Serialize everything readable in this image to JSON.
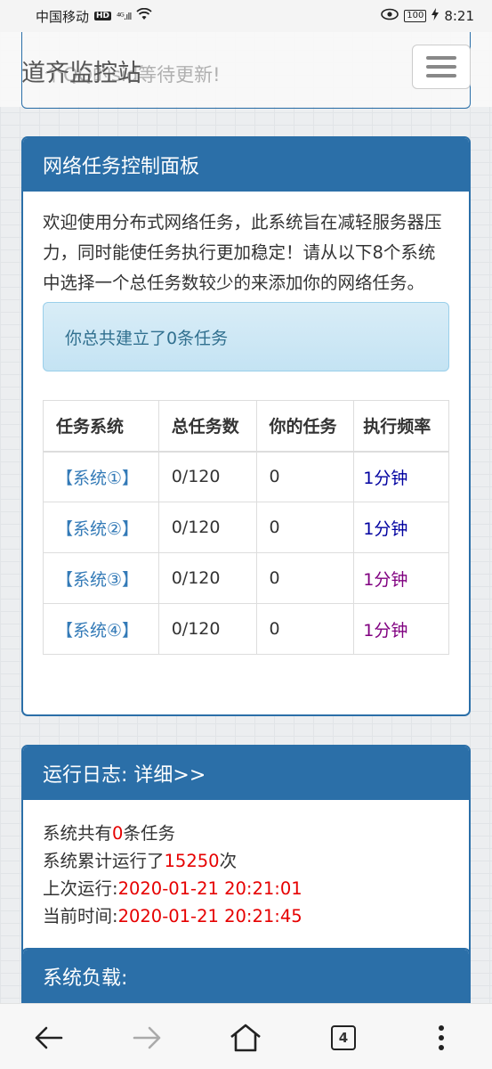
{
  "status_bar": {
    "carrier": "中国移动",
    "hd": "HD",
    "signal": "⁴ᴳ.ıll",
    "battery": "100",
    "time": "8:21"
  },
  "navbar": {
    "brand": "道齐监控站",
    "scrolled_text": "个QQ的sid等待更新!"
  },
  "task_panel": {
    "title": "网络任务控制面板",
    "intro": "欢迎使用分布式网络任务，此系统旨在减轻服务器压力，同时能使任务执行更加稳定！请从以下8个系统中选择一个总任务数较少的来添加你的网络任务。",
    "alert": "你总共建立了0条任务",
    "table": {
      "headers": [
        "任务系统",
        "总任务数",
        "你的任务",
        "执行频率"
      ],
      "rows": [
        {
          "system": "【系统①】",
          "total": "0/120",
          "mine": "0",
          "freq": "1分钟"
        },
        {
          "system": "【系统②】",
          "total": "0/120",
          "mine": "0",
          "freq": "1分钟"
        },
        {
          "system": "【系统③】",
          "total": "0/120",
          "mine": "0",
          "freq": "1分钟"
        },
        {
          "system": "【系统④】",
          "total": "0/120",
          "mine": "0",
          "freq": "1分钟"
        }
      ]
    }
  },
  "log_panel": {
    "title": "运行日志: 详细>>",
    "line1_prefix": "系统共有",
    "line1_value": "0",
    "line1_suffix": "条任务",
    "line2_prefix": "系统累计运行了",
    "line2_value": "15250",
    "line2_suffix": "次",
    "line3_prefix": "上次运行:",
    "line3_value": "2020-01-21 20:21:01",
    "line4_prefix": "当前时间:",
    "line4_value": "2020-01-21 20:21:45"
  },
  "load_panel": {
    "title": "系统负载:"
  },
  "bottom_nav": {
    "tabs_count": "4"
  },
  "colors": {
    "panel_primary": "#2b6fa8",
    "link": "#337ab7",
    "highlight_red": "#e60000",
    "alert_text": "#31708f"
  }
}
